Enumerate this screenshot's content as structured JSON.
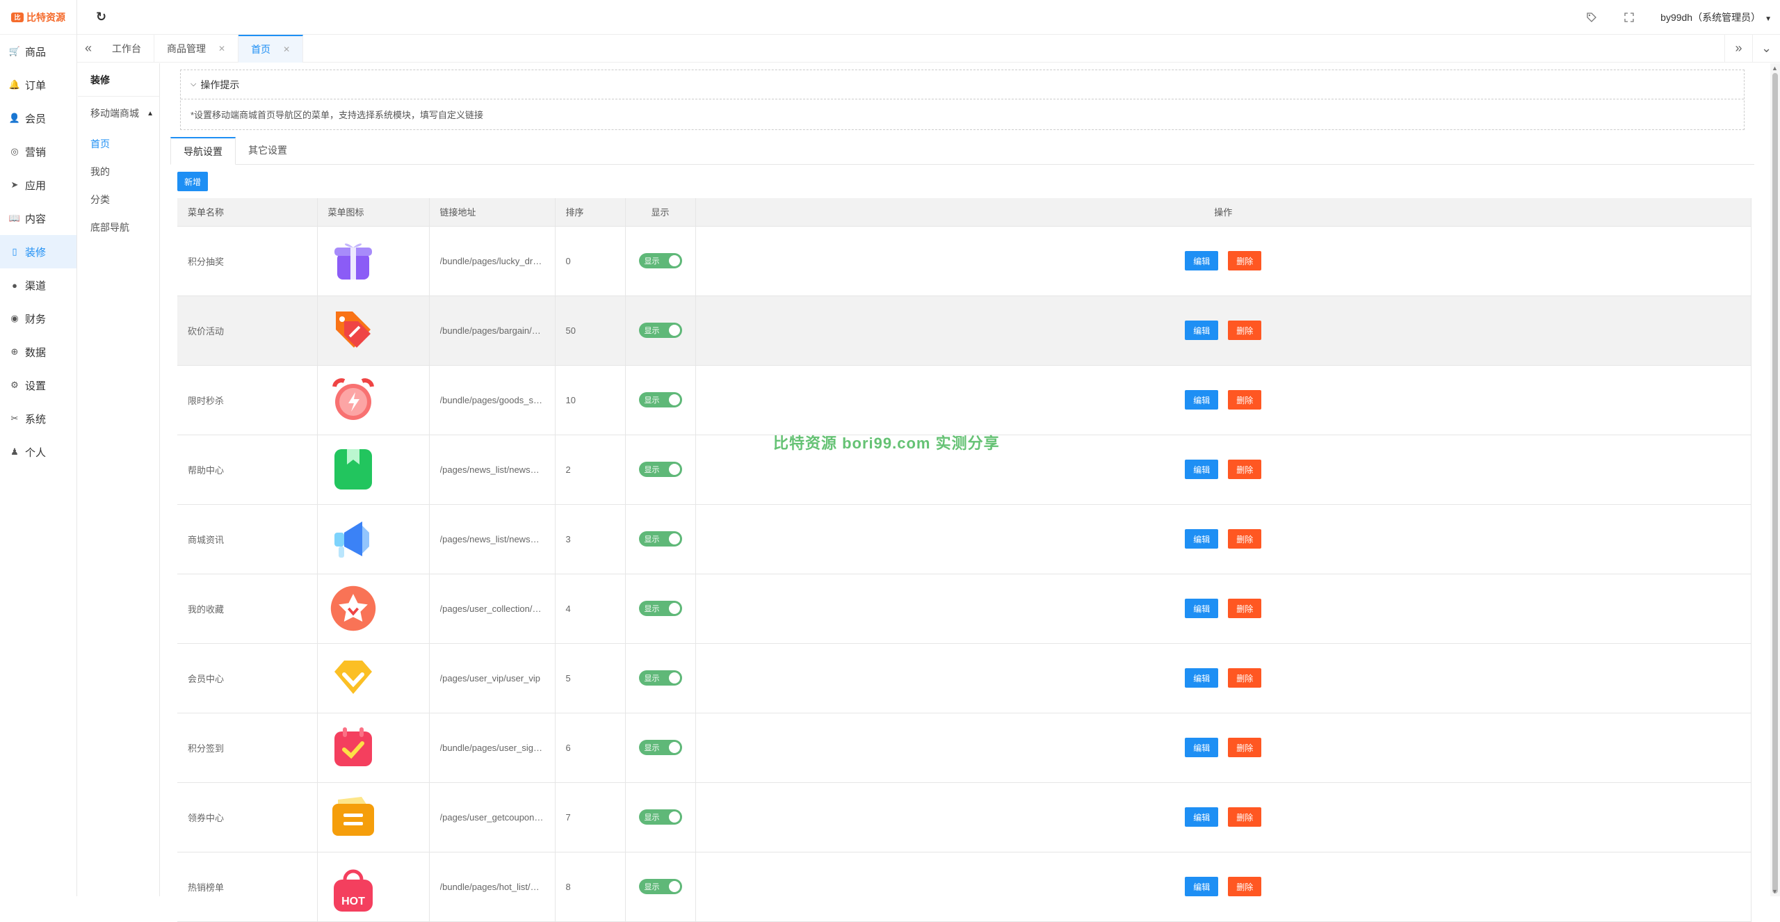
{
  "brand": {
    "logo_mark": "比",
    "logo_text": "比特资源"
  },
  "leftnav": [
    {
      "label": "商品",
      "icon": "cart-icon",
      "glyph": "🛒"
    },
    {
      "label": "订单",
      "icon": "bell-icon",
      "glyph": "🔔"
    },
    {
      "label": "会员",
      "icon": "user-icon",
      "glyph": "👤"
    },
    {
      "label": "营销",
      "icon": "target-icon",
      "glyph": "◎"
    },
    {
      "label": "应用",
      "icon": "send-icon",
      "glyph": "➤"
    },
    {
      "label": "内容",
      "icon": "book-icon",
      "glyph": "📖"
    },
    {
      "label": "装修",
      "icon": "mobile-icon",
      "glyph": "▯"
    },
    {
      "label": "渠道",
      "icon": "wechat-icon",
      "glyph": "●"
    },
    {
      "label": "财务",
      "icon": "wallet-icon",
      "glyph": "◉"
    },
    {
      "label": "数据",
      "icon": "globe-icon",
      "glyph": "⊕"
    },
    {
      "label": "设置",
      "icon": "gear-icon",
      "glyph": "⚙"
    },
    {
      "label": "系统",
      "icon": "tools-icon",
      "glyph": "✂"
    },
    {
      "label": "个人",
      "icon": "person-icon",
      "glyph": "♟"
    }
  ],
  "leftnav_active_index": 6,
  "topbar": {
    "user": "by99dh（系统管理员）"
  },
  "tabbar": {
    "tabs": [
      "工作台",
      "商品管理",
      "首页"
    ]
  },
  "subnav": {
    "title": "装修",
    "group": "移动端商城",
    "items": [
      "首页",
      "我的",
      "分类",
      "底部导航"
    ]
  },
  "tips": {
    "title": "操作提示",
    "body": "*设置移动端商城首页导航区的菜单，支持选择系统模块，填写自定义链接"
  },
  "tabs": [
    "导航设置",
    "其它设置"
  ],
  "add_label": "新增",
  "table": {
    "headers": [
      "菜单名称",
      "菜单图标",
      "链接地址",
      "排序",
      "显示",
      "操作"
    ],
    "toggle_label": "显示",
    "edit_label": "编辑",
    "delete_label": "删除",
    "rows": [
      {
        "name": "积分抽奖",
        "link": "/bundle/pages/lucky_draw/lucky_draw",
        "sort": "0",
        "icon": "gift-icon"
      },
      {
        "name": "砍价活动",
        "link": "/bundle/pages/bargain/bargain",
        "sort": "50",
        "icon": "price-tag-icon"
      },
      {
        "name": "限时秒杀",
        "link": "/bundle/pages/goods_seckill/goods_seckill",
        "sort": "10",
        "icon": "alarm-clock-icon"
      },
      {
        "name": "帮助中心",
        "link": "/pages/news_list/news_list",
        "sort": "2",
        "icon": "bookmark-icon"
      },
      {
        "name": "商城资讯",
        "link": "/pages/news_list/news_list",
        "sort": "3",
        "icon": "megaphone-icon"
      },
      {
        "name": "我的收藏",
        "link": "/pages/user_collection/user_collection",
        "sort": "4",
        "icon": "star-badge-icon"
      },
      {
        "name": "会员中心",
        "link": "/pages/user_vip/user_vip",
        "sort": "5",
        "icon": "diamond-icon"
      },
      {
        "name": "积分签到",
        "link": "/bundle/pages/user_sign/user_sign",
        "sort": "6",
        "icon": "calendar-check-icon"
      },
      {
        "name": "领券中心",
        "link": "/pages/user_getcoupon/user_getcoupon",
        "sort": "7",
        "icon": "coupon-icon"
      },
      {
        "name": "热销榜单",
        "link": "/bundle/pages/hot_list/hot_list",
        "sort": "8",
        "icon": "hot-bag-icon"
      }
    ]
  },
  "watermark": "比特资源 bori99.com 实测分享",
  "colors": {
    "primary": "#1e8ff4",
    "danger": "#ff5722",
    "toggle": "#5fb878",
    "brand": "#f56c2d"
  }
}
